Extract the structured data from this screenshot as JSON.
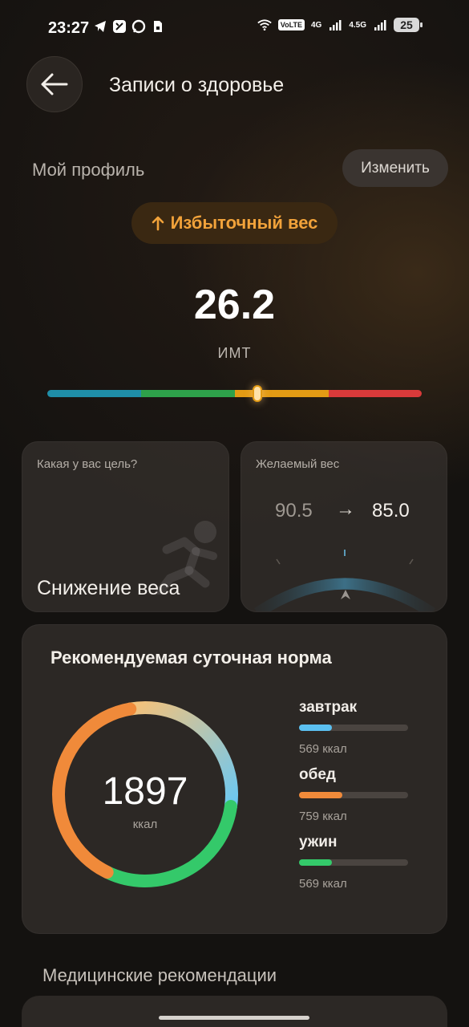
{
  "status_bar": {
    "time": "23:27",
    "network_1": "4G",
    "network_2": "4.5G",
    "volte": "VoLTE",
    "battery": "25"
  },
  "header": {
    "title": "Записи о здоровье",
    "back_icon": "arrow-left-icon"
  },
  "profile": {
    "label": "Мой профиль",
    "edit_label": "Изменить",
    "status_text": "Избыточный вес",
    "status_icon": "arrow-up-icon",
    "bmi_value": "26.2",
    "bmi_label": "ИМТ",
    "bmi_marker_fraction": 0.56,
    "scale_colors": [
      "#1f8ea8",
      "#2ea14a",
      "#e39b14",
      "#d93a3a"
    ]
  },
  "goal_card": {
    "caption": "Какая у вас цель?",
    "value": "Снижение веса",
    "icon": "runner-icon"
  },
  "weight_card": {
    "caption": "Желаемый вес",
    "current": "90.5",
    "target": "85.0",
    "arrow": "→"
  },
  "daily": {
    "title": "Рекомендуемая суточная норма",
    "total": "1897",
    "unit": "ккал",
    "meals": [
      {
        "name": "завтрак",
        "kcal": "569 ккал",
        "fraction": 0.3,
        "color": "#5bc0f0"
      },
      {
        "name": "обед",
        "kcal": "759 ккал",
        "fraction": 0.4,
        "color": "#f08a3a"
      },
      {
        "name": "ужин",
        "kcal": "569 ккал",
        "fraction": 0.3,
        "color": "#34c96a"
      }
    ]
  },
  "section": {
    "title": "Медицинские рекомендации"
  }
}
